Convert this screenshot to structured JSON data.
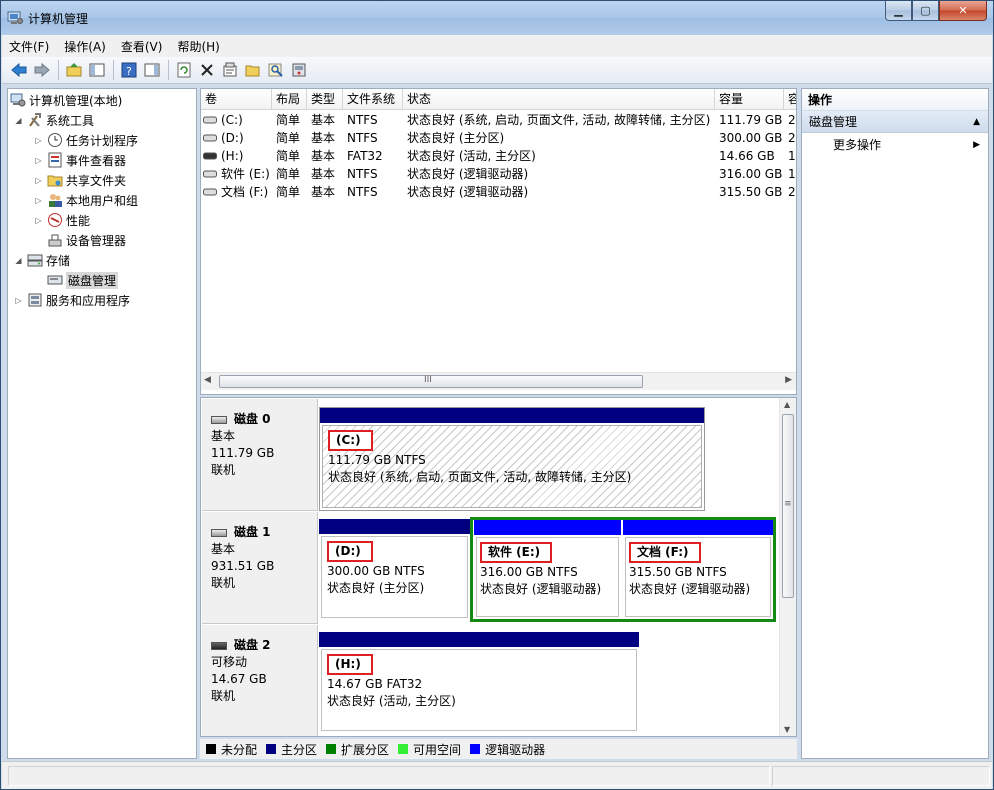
{
  "window": {
    "title": "计算机管理"
  },
  "window_buttons": {
    "minimize": "▁",
    "maximize": "▢",
    "close": "✕"
  },
  "menu": [
    "文件(F)",
    "操作(A)",
    "查看(V)",
    "帮助(H)"
  ],
  "toolbar_icons": [
    "back-icon",
    "forward-icon",
    "up-folder-icon",
    "show-hide-tree-icon",
    "help-icon",
    "show-hide-action-icon",
    "refresh-icon",
    "delete-icon",
    "properties-icon",
    "open-icon",
    "search-icon",
    "disk-settings-icon"
  ],
  "tree": [
    {
      "label": "计算机管理(本地)",
      "icon": "computer-management-icon"
    },
    {
      "label": "系统工具",
      "icon": "system-tools-icon"
    },
    {
      "label": "任务计划程序",
      "icon": "task-scheduler-icon"
    },
    {
      "label": "事件查看器",
      "icon": "event-viewer-icon"
    },
    {
      "label": "共享文件夹",
      "icon": "shared-folders-icon"
    },
    {
      "label": "本地用户和组",
      "icon": "local-users-icon"
    },
    {
      "label": "性能",
      "icon": "performance-icon"
    },
    {
      "label": "设备管理器",
      "icon": "device-manager-icon"
    },
    {
      "label": "存储",
      "icon": "storage-icon"
    },
    {
      "label": "磁盘管理",
      "icon": "disk-management-icon"
    },
    {
      "label": "服务和应用程序",
      "icon": "services-apps-icon"
    }
  ],
  "volume_list": {
    "columns": [
      "卷",
      "布局",
      "类型",
      "文件系统",
      "状态",
      "容量",
      "容"
    ],
    "rows": [
      {
        "volume": "(C:)",
        "layout": "简单",
        "type": "基本",
        "fs": "NTFS",
        "status": "状态良好 (系统, 启动, 页面文件, 活动, 故障转储, 主分区)",
        "capacity": "111.79 GB",
        "extra": "2"
      },
      {
        "volume": "(D:)",
        "layout": "简单",
        "type": "基本",
        "fs": "NTFS",
        "status": "状态良好 (主分区)",
        "capacity": "300.00 GB",
        "extra": "2"
      },
      {
        "volume": "(H:)",
        "layout": "简单",
        "type": "基本",
        "fs": "FAT32",
        "status": "状态良好 (活动, 主分区)",
        "capacity": "14.66 GB",
        "extra": "1"
      },
      {
        "volume": "软件 (E:)",
        "layout": "简单",
        "type": "基本",
        "fs": "NTFS",
        "status": "状态良好 (逻辑驱动器)",
        "capacity": "316.00 GB",
        "extra": "1"
      },
      {
        "volume": "文档 (F:)",
        "layout": "简单",
        "type": "基本",
        "fs": "NTFS",
        "status": "状态良好 (逻辑驱动器)",
        "capacity": "315.50 GB",
        "extra": "2"
      }
    ],
    "hscroll_grip": "III"
  },
  "disks": [
    {
      "name": "磁盘 0",
      "type": "基本",
      "size": "111.79 GB",
      "state": "联机",
      "partitions": [
        {
          "label": "(C:)",
          "size": "111.79 GB NTFS",
          "status": "状态良好 (系统, 启动, 页面文件, 活动, 故障转储, 主分区)"
        }
      ]
    },
    {
      "name": "磁盘 1",
      "type": "基本",
      "size": "931.51 GB",
      "state": "联机",
      "partitions": [
        {
          "label": "(D:)",
          "size": "300.00 GB NTFS",
          "status": "状态良好 (主分区)"
        },
        {
          "label": "软件  (E:)",
          "size": "316.00 GB NTFS",
          "status": "状态良好 (逻辑驱动器)"
        },
        {
          "label": "文档  (F:)",
          "size": "315.50 GB NTFS",
          "status": "状态良好 (逻辑驱动器)"
        }
      ]
    },
    {
      "name": "磁盘 2",
      "type": "可移动",
      "size": "14.67 GB",
      "state": "联机",
      "partitions": [
        {
          "label": "(H:)",
          "size": "14.67 GB FAT32",
          "status": "状态良好 (活动, 主分区)"
        }
      ]
    }
  ],
  "legend": [
    {
      "label": "未分配",
      "color": "#000000"
    },
    {
      "label": "主分区",
      "color": "#000080"
    },
    {
      "label": "扩展分区",
      "color": "#008000"
    },
    {
      "label": "可用空间",
      "color": "#33ee33"
    },
    {
      "label": "逻辑驱动器",
      "color": "#0000ff"
    }
  ],
  "colors": {
    "primary_bar": "#000080",
    "logical_bar": "#0000ff",
    "extended_border": "#138a13",
    "highlight_box": "#e02020"
  },
  "actions": {
    "header": "操作",
    "section": "磁盘管理",
    "items": [
      "更多操作"
    ]
  }
}
